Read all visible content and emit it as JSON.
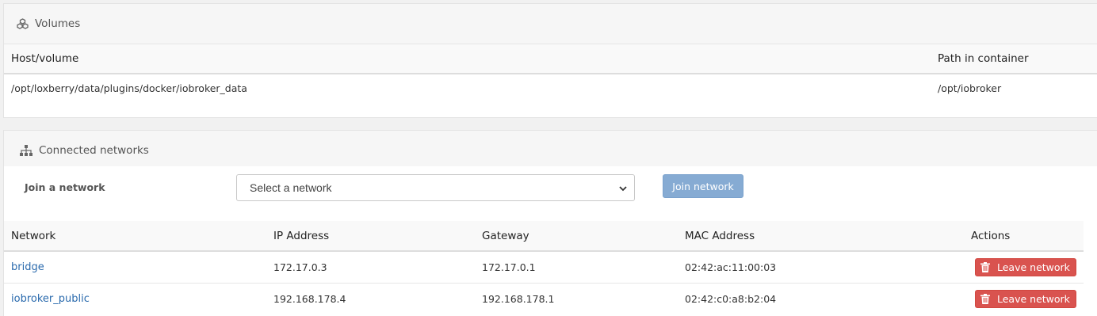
{
  "volumes": {
    "title": "Volumes",
    "icon": "cubes-icon",
    "columns": [
      "Host/volume",
      "Path in container"
    ],
    "rows": [
      {
        "host": "/opt/loxberry/data/plugins/docker/iobroker_data",
        "path": "/opt/iobroker"
      }
    ]
  },
  "networks": {
    "title": "Connected networks",
    "icon": "sitemap-icon",
    "join_label": "Join a network",
    "select_value": "Select a network",
    "join_button": "Join network",
    "columns": [
      "Network",
      "IP Address",
      "Gateway",
      "MAC Address",
      "Actions"
    ],
    "rows": [
      {
        "name": "bridge",
        "ip": "172.17.0.3",
        "gateway": "172.17.0.1",
        "mac": "02:42:ac:11:00:03",
        "action": "Leave network"
      },
      {
        "name": "iobroker_public",
        "ip": "192.168.178.4",
        "gateway": "192.168.178.1",
        "mac": "02:42:c0:a8:b2:04",
        "action": "Leave network"
      }
    ]
  },
  "colors": {
    "link": "#2a6aad",
    "danger": "#d9534f",
    "primary_disabled": "#86abd3"
  }
}
